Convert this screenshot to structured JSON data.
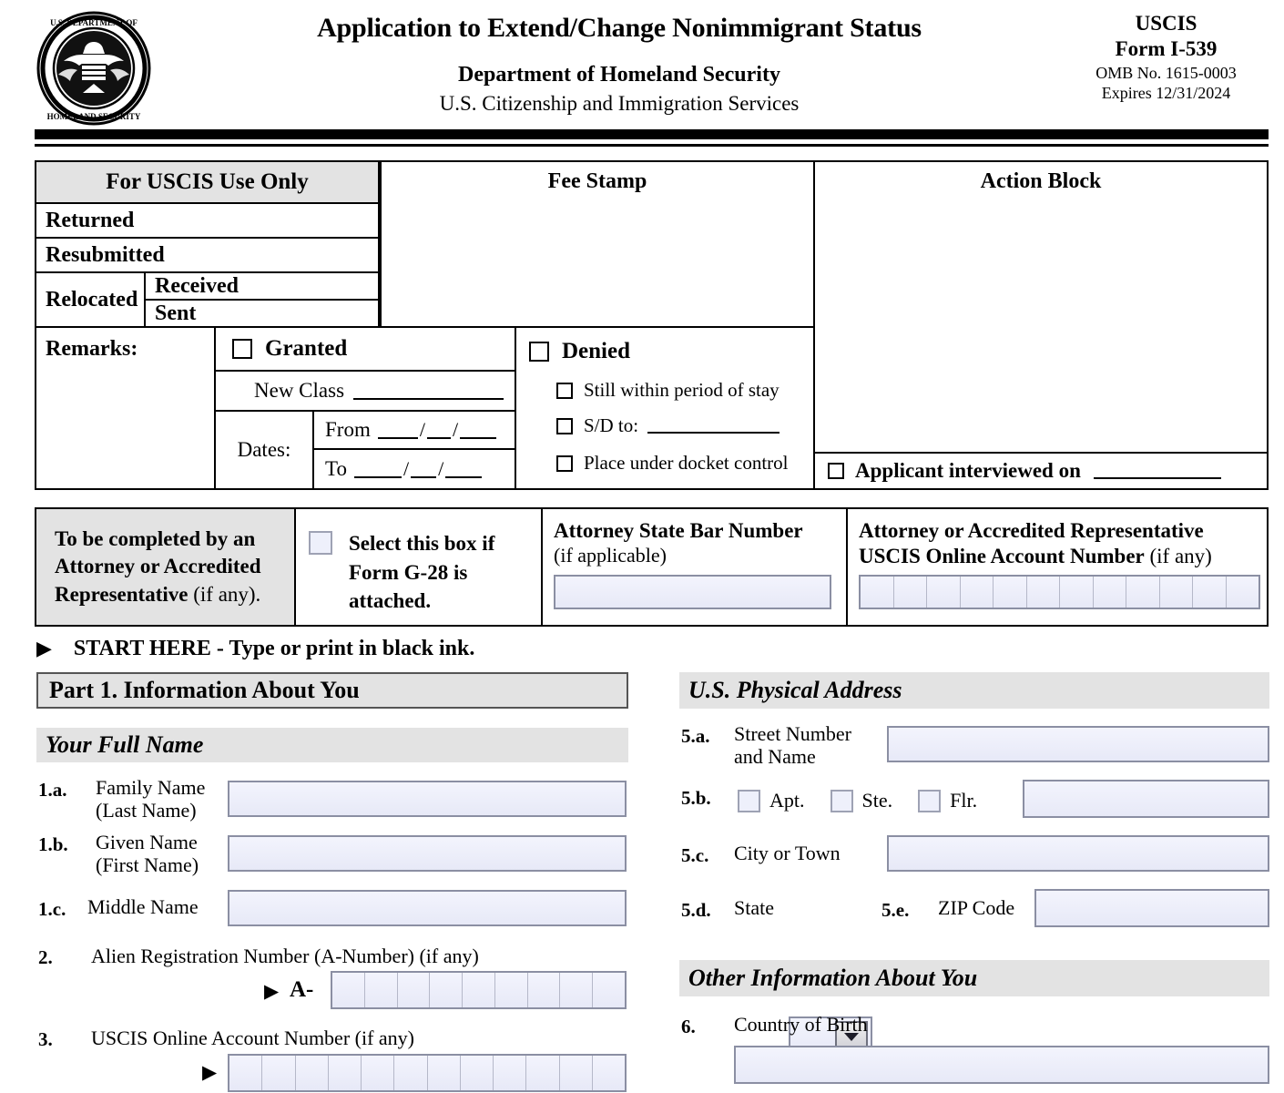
{
  "header": {
    "title": "Application to Extend/Change Nonimmigrant Status",
    "dhs": "Department of Homeland Security",
    "uscis": "U.S. Citizenship and Immigration Services",
    "agency": "USCIS",
    "form_no": "Form I-539",
    "omb": "OMB No. 1615-0003",
    "expires": "Expires 12/31/2024",
    "seal_alt": "dhs-seal-icon"
  },
  "uscis_block": {
    "title": "For USCIS Use Only",
    "returned": "Returned",
    "resubmitted": "Resubmitted",
    "relocated": "Relocated",
    "received": "Received",
    "sent": "Sent",
    "remarks": "Remarks:",
    "fee_stamp": "Fee Stamp",
    "action_block": "Action Block",
    "granted": "Granted",
    "new_class": "New Class",
    "dates": "Dates:",
    "from": "From",
    "to": "To",
    "date_sep": "/",
    "denied": "Denied",
    "still_within": "Still within period of stay",
    "sd_to": "S/D to:",
    "docket": "Place under docket control",
    "interviewed": "Applicant interviewed on"
  },
  "attorney": {
    "to_be_completed_1": "To be completed by an",
    "to_be_completed_2": "Attorney or Accredited",
    "to_be_completed_3": "Representative",
    "to_be_completed_3b": " (if any).",
    "g28_line1": "Select this box if",
    "g28_line2": "Form G-28 is",
    "g28_line3": "attached.",
    "bar_label": "Attorney State Bar Number",
    "bar_sub": "(if applicable)",
    "online_label_1": "Attorney or Accredited Representative",
    "online_label_2": "USCIS Online Account Number",
    "online_label_2b": " (if any)",
    "online_cells": 12
  },
  "start_here": {
    "arrow": "▶",
    "text": "START HERE - Type or print in black ink."
  },
  "part1": {
    "heading": "Part 1.  Information About You",
    "full_name_heading": "Your Full Name",
    "fields": [
      {
        "num": "1.a.",
        "label_1": "Family Name",
        "label_2": "(Last Name)"
      },
      {
        "num": "1.b.",
        "label_1": "Given Name",
        "label_2": "(First Name)"
      },
      {
        "num": "1.c.",
        "label_1": "Middle Name",
        "label_2": ""
      }
    ],
    "alien": {
      "num": "2.",
      "label": "Alien Registration Number (A-Number) (if any)",
      "arrow": "▶",
      "prefix": "A-",
      "cells": 9
    },
    "online_acct": {
      "num": "3.",
      "label": "USCIS Online Account Number (if any)",
      "arrow": "▶",
      "cells": 12
    }
  },
  "address": {
    "heading": "U.S. Physical Address",
    "street": {
      "num": "5.a.",
      "label_1": "Street Number",
      "label_2": "and Name"
    },
    "unit": {
      "num": "5.b.",
      "apt": "Apt.",
      "ste": "Ste.",
      "flr": "Flr."
    },
    "city": {
      "num": "5.c.",
      "label": "City or Town"
    },
    "state": {
      "num": "5.d.",
      "label": "State",
      "value": ""
    },
    "zip": {
      "num": "5.e.",
      "label": "ZIP Code"
    }
  },
  "other_info": {
    "heading": "Other Information About You",
    "country_of_birth": {
      "num": "6.",
      "label": "Country of Birth"
    }
  },
  "colors": {
    "field_fill": "#eef0fb",
    "field_border": "#8b8fa3",
    "shade": "#e3e3e3",
    "ink": "#000000"
  }
}
